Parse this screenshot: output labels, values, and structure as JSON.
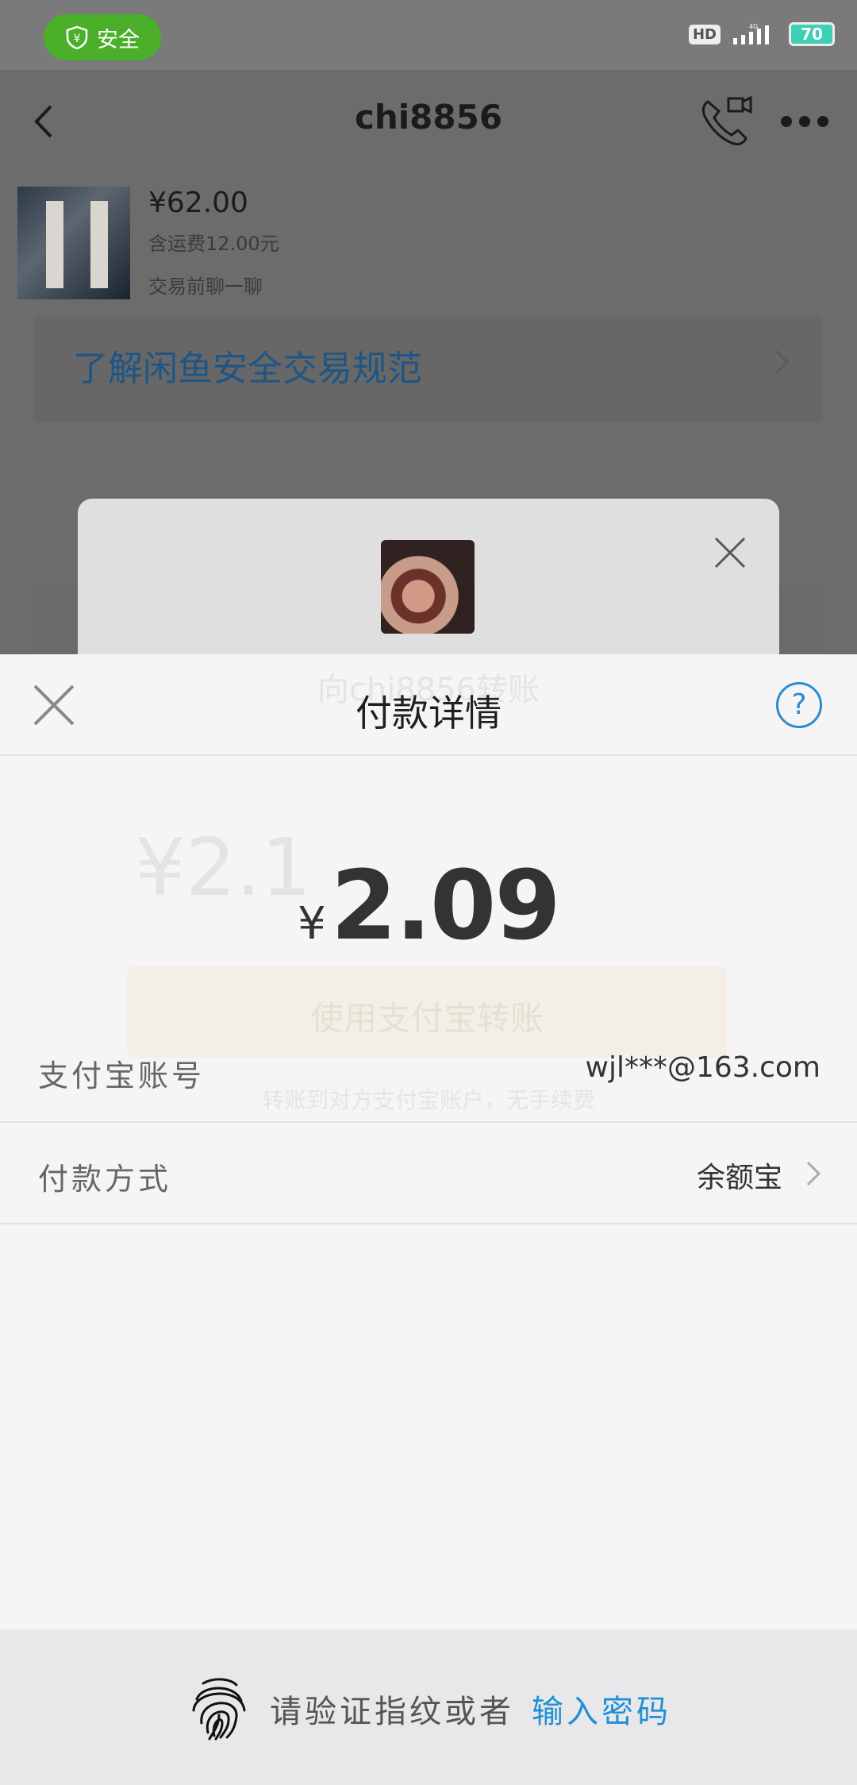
{
  "status_bar": {
    "secure_label": "安全",
    "hd": "HD",
    "network": "4G",
    "battery": "70"
  },
  "chat": {
    "title": "chi8856"
  },
  "product": {
    "price": "¥62.00",
    "shipping": "含运费12.00元",
    "chat_prompt": "交易前聊一聊"
  },
  "safety_banner": {
    "text": "了解闲鱼安全交易规范"
  },
  "transfer_dialog": {
    "title": "向chi8856转账",
    "amount": "¥2.1",
    "button": "使用支付宝转账",
    "note": "转账到对方支付宝账户，无手续费"
  },
  "payment_sheet": {
    "title": "付款详情",
    "help": "?",
    "currency": "¥",
    "amount": "2.09",
    "account_label": "支付宝账号",
    "account_value": "wjl***@163.com",
    "method_label": "付款方式",
    "method_value": "余额宝"
  },
  "verify": {
    "prompt": "请验证指纹或者",
    "link": "输入密码"
  },
  "colors": {
    "secure_green": "#4caf2a",
    "link_blue": "#1f8fd6",
    "help_blue": "#2d8bd0"
  }
}
